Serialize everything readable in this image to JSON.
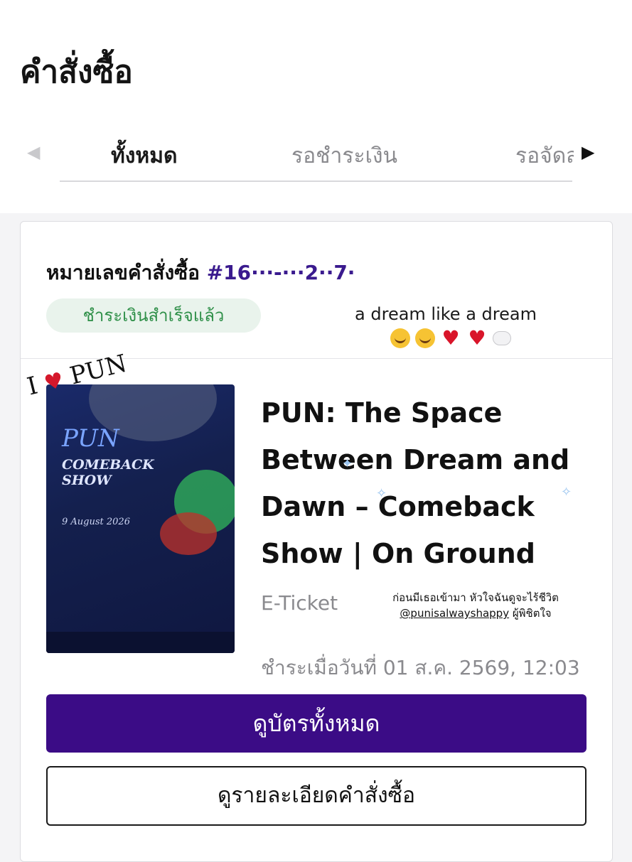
{
  "page": {
    "title": "คำสั่งซื้อ"
  },
  "tabs": {
    "items": [
      "ทั้งหมด",
      "รอชำระเงิน",
      "รอจัดส่ง"
    ],
    "active": 0
  },
  "order": {
    "number_label": "หมายเลขคำสั่งซื้อ",
    "number_value": "#16···-···2··7·",
    "status": "ชำระเงินสำเร็จแล้ว",
    "status_color": "#2e8f48",
    "overlay_note": "a dream like a dream",
    "event": {
      "title": "PUN: The Space Between Dream and Dawn – Comeback Show | On Ground",
      "ticket_type": "E-Ticket",
      "paid_at": "ชำระเมื่อวันที่ 01 ส.ค. 2569, 12:03"
    },
    "poster": {
      "title": "PUN",
      "subtitle": "COMEBACK SHOW",
      "date": "9 August 2026"
    },
    "sticker": {
      "text_left": "I",
      "text_right": "PUN"
    },
    "overlay_caption": {
      "line1": "ก่อนมีเธอเข้ามา หัวใจฉันดูจะไร้ชีวิต",
      "handle": "@punisalwayshappy",
      "line2_suffix": " ผู้พิชิตใจ"
    },
    "buttons": {
      "view_tickets": "ดูบัตรทั้งหมด",
      "view_details": "ดูรายละเอียดคำสั่งซื้อ"
    }
  },
  "colors": {
    "brand_primary": "#3b0c86",
    "order_id": "#3a1a8e"
  }
}
